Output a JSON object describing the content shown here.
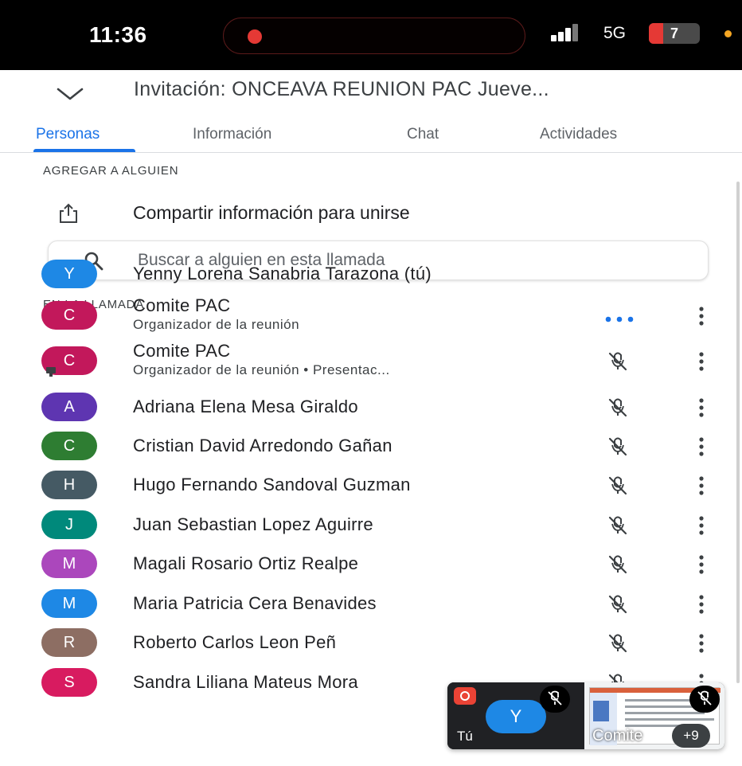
{
  "status_bar": {
    "time": "11:36",
    "network": "5G",
    "battery": "7"
  },
  "header": {
    "title": "Invitación: ONCEAVA REUNION PAC Jueve..."
  },
  "tabs": [
    {
      "label": "Personas",
      "active": true
    },
    {
      "label": "Información",
      "active": false
    },
    {
      "label": "Chat",
      "active": false
    },
    {
      "label": "Actividades",
      "active": false
    }
  ],
  "add_section": {
    "label": "AGREGAR A ALGUIEN",
    "share_label": "Compartir información para unirse"
  },
  "search": {
    "placeholder": "Buscar a alguien en esta llamada"
  },
  "in_call": {
    "label": "EN LA LLAMADA",
    "participants": [
      {
        "initial": "Y",
        "name": "Yenny Lorena Sanabria Tarazona (tú)",
        "subtitle": "",
        "color": "#1e88e5",
        "status": "none"
      },
      {
        "initial": "C",
        "name": "Comite PAC",
        "subtitle": "Organizador de la reunión",
        "color": "#c2185b",
        "status": "speaking"
      },
      {
        "initial": "C",
        "name": "Comite PAC",
        "subtitle": "Organizador de la reunión • Presentac...",
        "color": "#c2185b",
        "status": "muted"
      },
      {
        "initial": "A",
        "name": "Adriana Elena Mesa Giraldo",
        "subtitle": "",
        "color": "#5e35b1",
        "status": "muted"
      },
      {
        "initial": "C",
        "name": "Cristian David Arredondo Gañan",
        "subtitle": "",
        "color": "#2e7d32",
        "status": "muted"
      },
      {
        "initial": "H",
        "name": "Hugo Fernando Sandoval Guzman",
        "subtitle": "",
        "color": "#455a64",
        "status": "muted"
      },
      {
        "initial": "J",
        "name": "Juan Sebastian Lopez Aguirre",
        "subtitle": "",
        "color": "#00897b",
        "status": "muted"
      },
      {
        "initial": "M",
        "name": "Magali Rosario Ortiz Realpe",
        "subtitle": "",
        "color": "#ab47bc",
        "status": "muted"
      },
      {
        "initial": "M",
        "name": "Maria Patricia Cera Benavides",
        "subtitle": "",
        "color": "#1e88e5",
        "status": "muted"
      },
      {
        "initial": "R",
        "name": "Roberto Carlos Leon Peñ",
        "subtitle": "",
        "color": "#8d6e63",
        "status": "muted"
      },
      {
        "initial": "S",
        "name": "Sandra Liliana Mateus Mora",
        "subtitle": "",
        "color": "#d81b60",
        "status": "muted"
      }
    ]
  },
  "pip": {
    "self_initial": "Y",
    "self_label": "Tú",
    "presenter_label": "Comite",
    "more_count": "+9"
  },
  "colors": {
    "accent": "#1a73e8",
    "record": "#ea4335"
  }
}
